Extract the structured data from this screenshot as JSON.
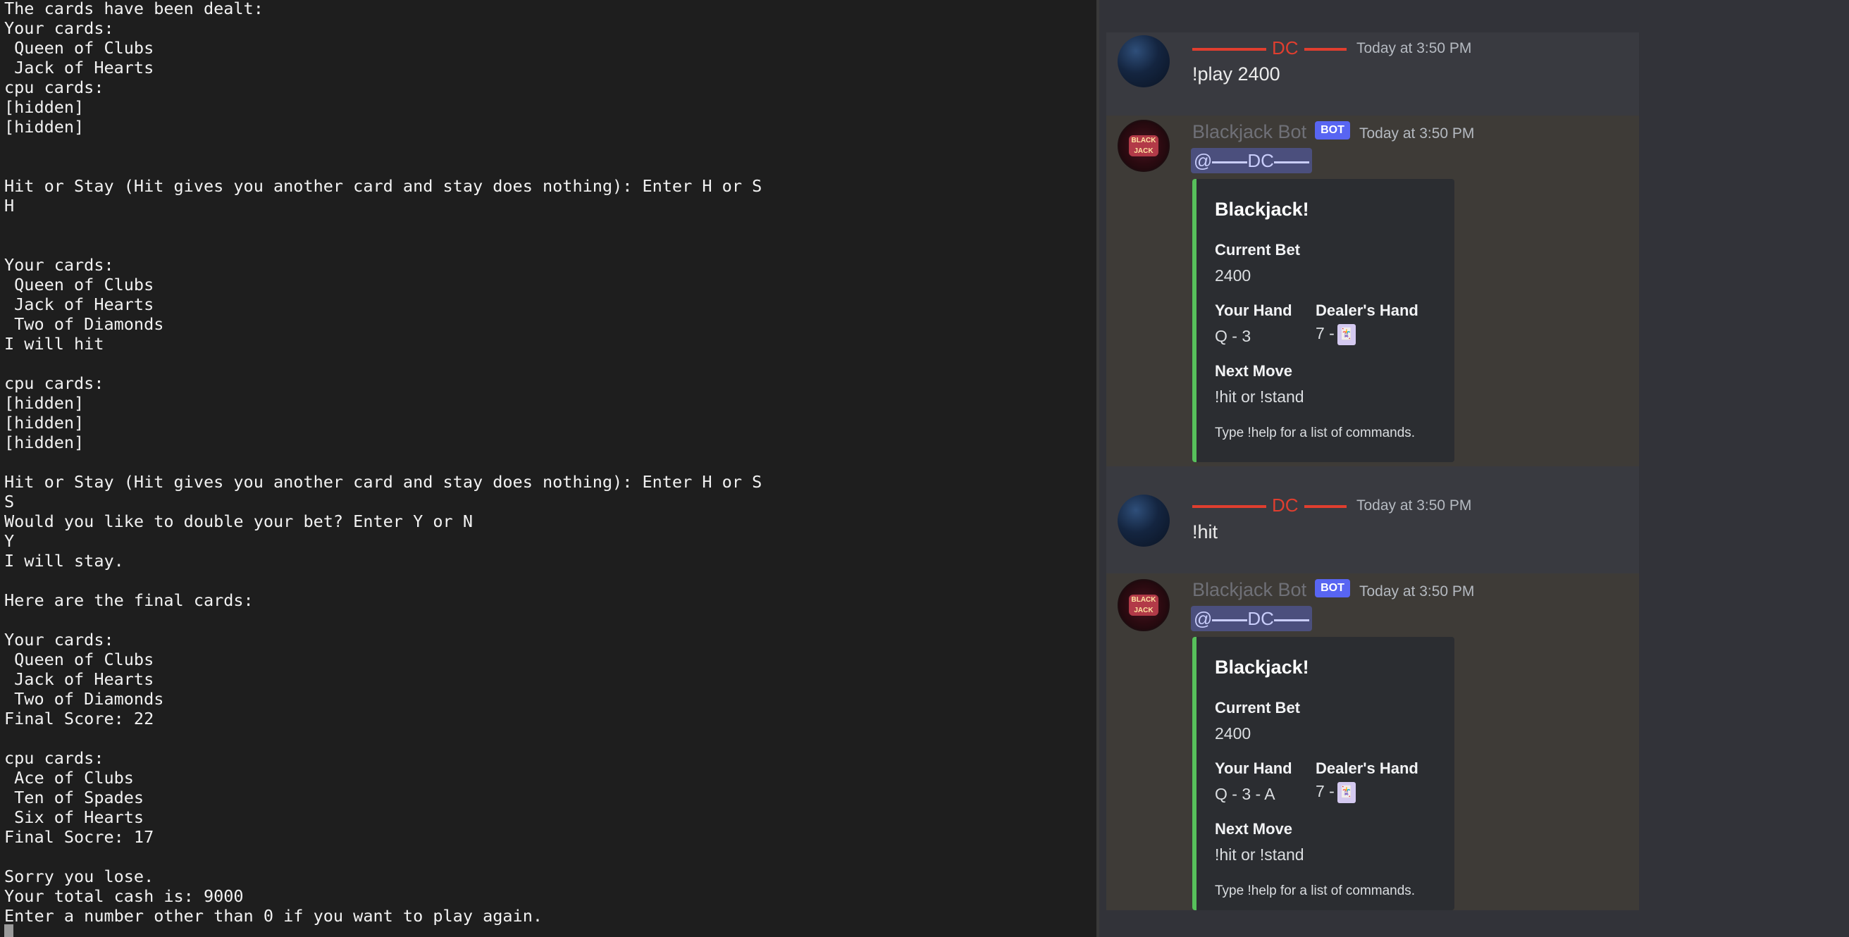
{
  "terminal": {
    "lines": [
      "The cards have been dealt:",
      "Your cards:",
      " Queen of Clubs",
      " Jack of Hearts",
      "cpu cards:",
      "[hidden]",
      "[hidden]",
      "",
      "",
      "Hit or Stay (Hit gives you another card and stay does nothing): Enter H or S",
      "H",
      "",
      "",
      "Your cards:",
      " Queen of Clubs",
      " Jack of Hearts",
      " Two of Diamonds",
      "I will hit",
      "",
      "cpu cards:",
      "[hidden]",
      "[hidden]",
      "[hidden]",
      "",
      "Hit or Stay (Hit gives you another card and stay does nothing): Enter H or S",
      "S",
      "Would you like to double your bet? Enter Y or N",
      "Y",
      "I will stay.",
      "",
      "Here are the final cards:",
      "",
      "Your cards:",
      " Queen of Clubs",
      " Jack of Hearts",
      " Two of Diamonds",
      "Final Score: 22",
      "",
      "cpu cards:",
      " Ace of Clubs",
      " Ten of Spades",
      " Six of Hearts",
      "Final Socre: 17",
      "",
      "Sorry you lose.",
      "Your total cash is: 9000",
      "Enter a number other than 0 if you want to play again."
    ]
  },
  "discord": {
    "user_name": "DC",
    "bot_name": "Blackjack Bot",
    "bot_badge": "BOT",
    "bot_avatar_text": "BLACK JACK",
    "messages": [
      {
        "timestamp": "Today at 3:50 PM",
        "text": "!play 2400"
      },
      {
        "timestamp": "Today at 3:50 PM",
        "mention_prefix": "@",
        "embed": {
          "title": "Blackjack!",
          "bet_label": "Current Bet",
          "bet_value": "2400",
          "your_hand_label": "Your Hand",
          "your_hand_value": "Q - 3",
          "dealer_hand_label": "Dealer's Hand",
          "dealer_hand_value": "7 -",
          "next_move_label": "Next Move",
          "next_move_value": "!hit or !stand",
          "footer": "Type !help for a list of commands."
        }
      },
      {
        "timestamp": "Today at 3:50 PM",
        "text": "!hit"
      },
      {
        "timestamp": "Today at 3:50 PM",
        "mention_prefix": "@",
        "embed": {
          "title": "Blackjack!",
          "bet_label": "Current Bet",
          "bet_value": "2400",
          "your_hand_label": "Your Hand",
          "your_hand_value": "Q - 3 - A",
          "dealer_hand_label": "Dealer's Hand",
          "dealer_hand_value": "7 -",
          "next_move_label": "Next Move",
          "next_move_value": "!hit or !stand",
          "footer": "Type !help for a list of commands."
        }
      }
    ],
    "colors": {
      "embed_accent": "#57c05b",
      "user_name_color": "#e03e2f",
      "bot_badge_color": "#5865f2"
    }
  }
}
